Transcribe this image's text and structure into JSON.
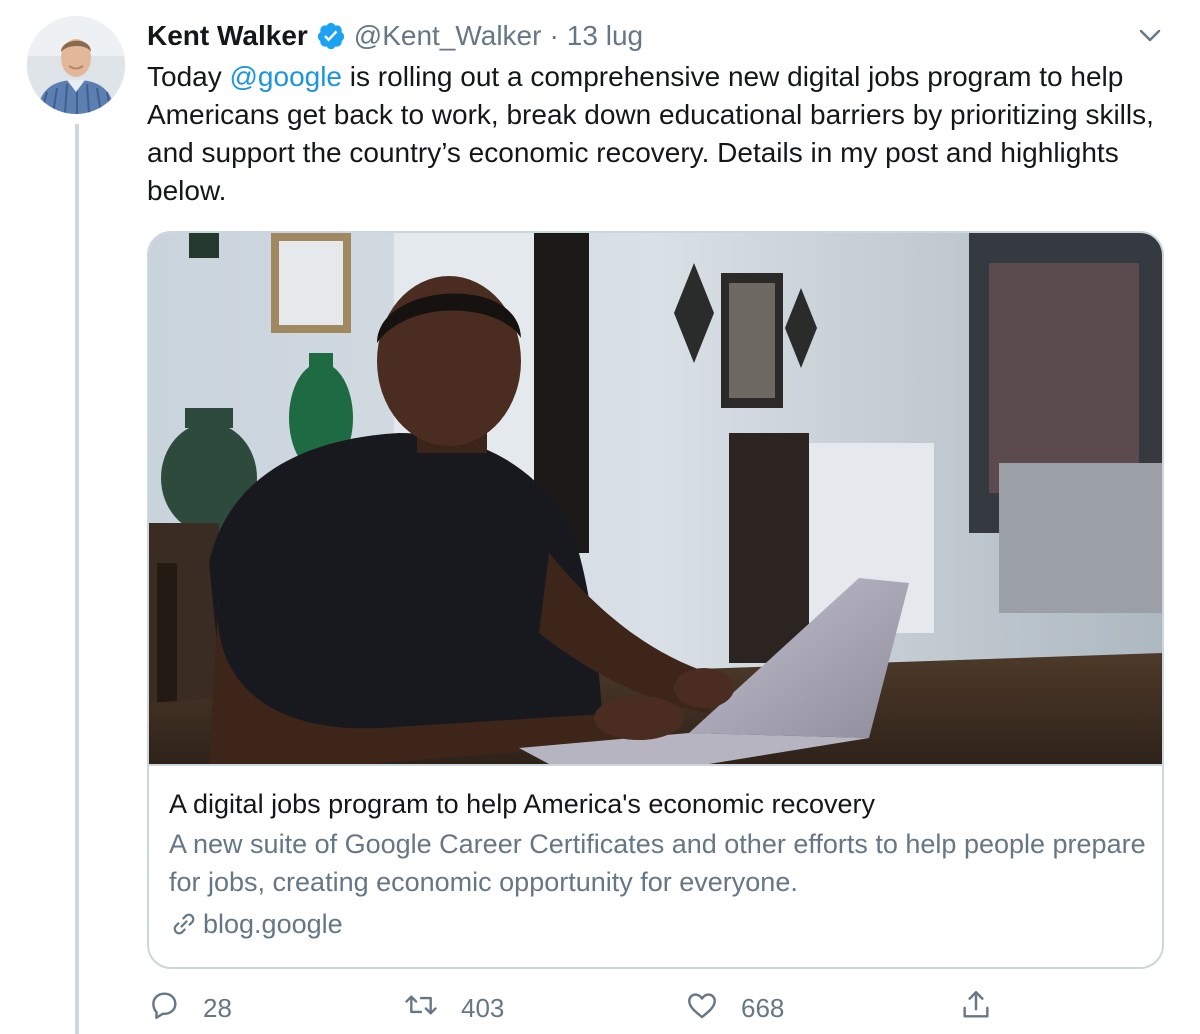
{
  "author": {
    "name": "Kent Walker",
    "handle": "@Kent_Walker",
    "separator": "·",
    "date": "13 lug",
    "avatar_icon": "profile-photo",
    "verified_icon": "verified-badge-icon",
    "verified_color": "#1da1f2"
  },
  "tweet": {
    "text_before": "Today ",
    "mention": "@google",
    "text_after": " is rolling out a comprehensive new digital jobs program to help Americans get back to work, break down educational barriers by prioritizing skills, and support the country’s economic recovery. Details in my post and highlights below."
  },
  "card": {
    "image_icon": "man-working-on-laptop-photo",
    "title": "A digital jobs program to help America's economic recovery",
    "description": "A new suite of Google Career Certificates and other efforts to help people prepare for jobs, creating economic opportunity for everyone.",
    "domain": "blog.google",
    "link_icon": "link-icon"
  },
  "actions": {
    "reply": {
      "icon": "reply-icon",
      "count": "28"
    },
    "retweet": {
      "icon": "retweet-icon",
      "count": "403"
    },
    "like": {
      "icon": "heart-icon",
      "count": "668"
    },
    "share": {
      "icon": "share-icon"
    }
  },
  "colors": {
    "text": "#14171a",
    "secondary": "#657786",
    "link": "#1b95e0",
    "border": "#ccd6dd"
  }
}
